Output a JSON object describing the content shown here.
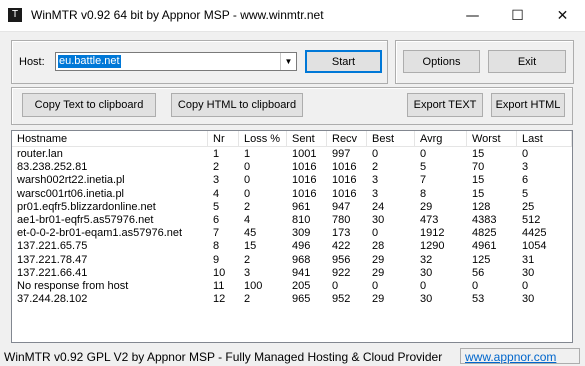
{
  "window": {
    "title": "WinMTR v0.92 64 bit by Appnor MSP - www.winmtr.net",
    "app_icon": "T",
    "controls": {
      "minimize": "—",
      "maximize": "☐",
      "close": "✕"
    }
  },
  "host": {
    "label": "Host:",
    "value": "eu.battle.net",
    "dropdown_arrow": "▼"
  },
  "buttons": {
    "start": "Start",
    "options": "Options",
    "exit": "Exit",
    "copy_text": "Copy Text to clipboard",
    "copy_html": "Copy HTML to clipboard",
    "export_text": "Export TEXT",
    "export_html": "Export HTML"
  },
  "table": {
    "columns": [
      "Hostname",
      "Nr",
      "Loss %",
      "Sent",
      "Recv",
      "Best",
      "Avrg",
      "Worst",
      "Last"
    ],
    "rows": [
      [
        "router.lan",
        "1",
        "1",
        "1001",
        "997",
        "0",
        "0",
        "15",
        "0"
      ],
      [
        "83.238.252.81",
        "2",
        "0",
        "1016",
        "1016",
        "2",
        "5",
        "70",
        "3"
      ],
      [
        "warsh002rt22.inetia.pl",
        "3",
        "0",
        "1016",
        "1016",
        "3",
        "7",
        "15",
        "6"
      ],
      [
        "warsc001rt06.inetia.pl",
        "4",
        "0",
        "1016",
        "1016",
        "3",
        "8",
        "15",
        "5"
      ],
      [
        "pr01.eqfr5.blizzardonline.net",
        "5",
        "2",
        "961",
        "947",
        "24",
        "29",
        "128",
        "25"
      ],
      [
        "ae1-br01-eqfr5.as57976.net",
        "6",
        "4",
        "810",
        "780",
        "30",
        "473",
        "4383",
        "512"
      ],
      [
        "et-0-0-2-br01-eqam1.as57976.net",
        "7",
        "45",
        "309",
        "173",
        "0",
        "1912",
        "4825",
        "4425"
      ],
      [
        "137.221.65.75",
        "8",
        "15",
        "496",
        "422",
        "28",
        "1290",
        "4961",
        "1054"
      ],
      [
        "137.221.78.47",
        "9",
        "2",
        "968",
        "956",
        "29",
        "32",
        "125",
        "31"
      ],
      [
        "137.221.66.41",
        "10",
        "3",
        "941",
        "922",
        "29",
        "30",
        "56",
        "30"
      ],
      [
        "No response from host",
        "11",
        "100",
        "205",
        "0",
        "0",
        "0",
        "0",
        "0"
      ],
      [
        "37.244.28.102",
        "12",
        "2",
        "965",
        "952",
        "29",
        "30",
        "53",
        "30"
      ]
    ]
  },
  "statusbar": {
    "text": "WinMTR v0.92 GPL V2 by Appnor MSP - Fully Managed Hosting & Cloud Provider",
    "link": "www.appnor.com"
  }
}
